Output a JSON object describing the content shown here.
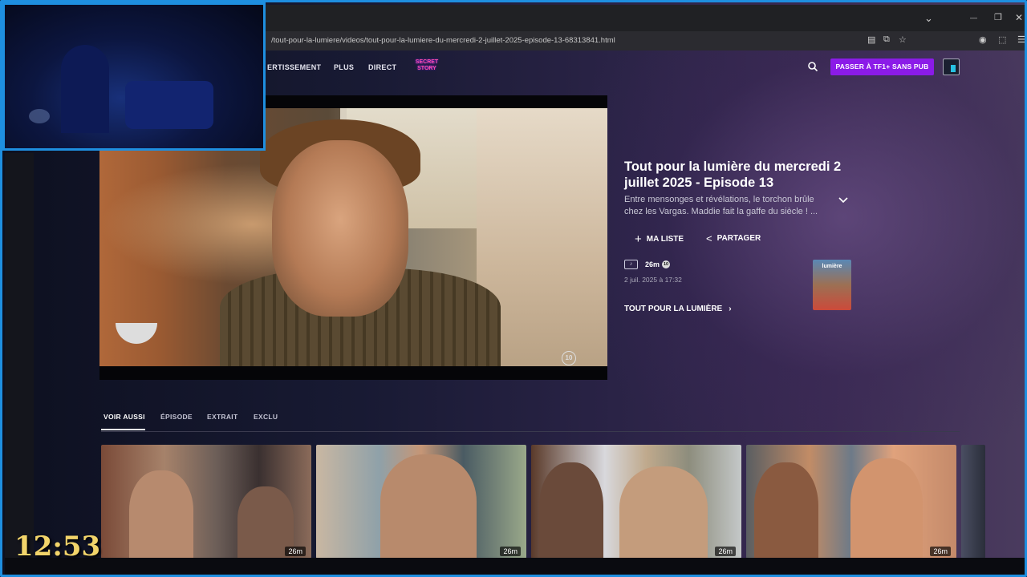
{
  "browser": {
    "url": "/tout-pour-la-lumiere/videos/tout-pour-la-lumiere-du-mercredi-2-juillet-2025-episode-13-68313841.html",
    "controls": {
      "dropdown": "⌄",
      "minimize": "—",
      "restore": "❐",
      "close": "✕"
    }
  },
  "nav": {
    "items": [
      "ERTISSEMENT",
      "PLUS",
      "DIRECT"
    ],
    "secret_story_logo": "SECRET STORY",
    "cta_label": "PASSER À TF1+ SANS PUB"
  },
  "player": {
    "channel_logo": "10"
  },
  "episode": {
    "title": "Tout pour la lumière du mercredi 2 juillet 2025 - Episode 13",
    "description": "Entre mensonges et révélations, le torchon brûle chez les Vargas. Maddie fait la gaffe du siècle ! ...",
    "actions": {
      "my_list": "MA LISTE",
      "share": "PARTAGER"
    },
    "duration": "26m",
    "age_rating": "10",
    "date": "2 juil. 2025 à 17:32",
    "show_link": "TOUT POUR LA LUMIÈRE",
    "poster_title": "lumière"
  },
  "tabs": [
    {
      "label": "VOIR AUSSI",
      "active": true
    },
    {
      "label": "ÉPISODE",
      "active": false
    },
    {
      "label": "EXTRAIT",
      "active": false
    },
    {
      "label": "EXCLU",
      "active": false
    }
  ],
  "thumbnails": [
    {
      "duration": "26m"
    },
    {
      "duration": "26m"
    },
    {
      "duration": "26m"
    },
    {
      "duration": "26m"
    }
  ],
  "overlay": {
    "clock": "12:53"
  },
  "colors": {
    "accent": "#8b1be8",
    "frame_border": "#1e8fe0",
    "clock": "#f2d46a"
  }
}
